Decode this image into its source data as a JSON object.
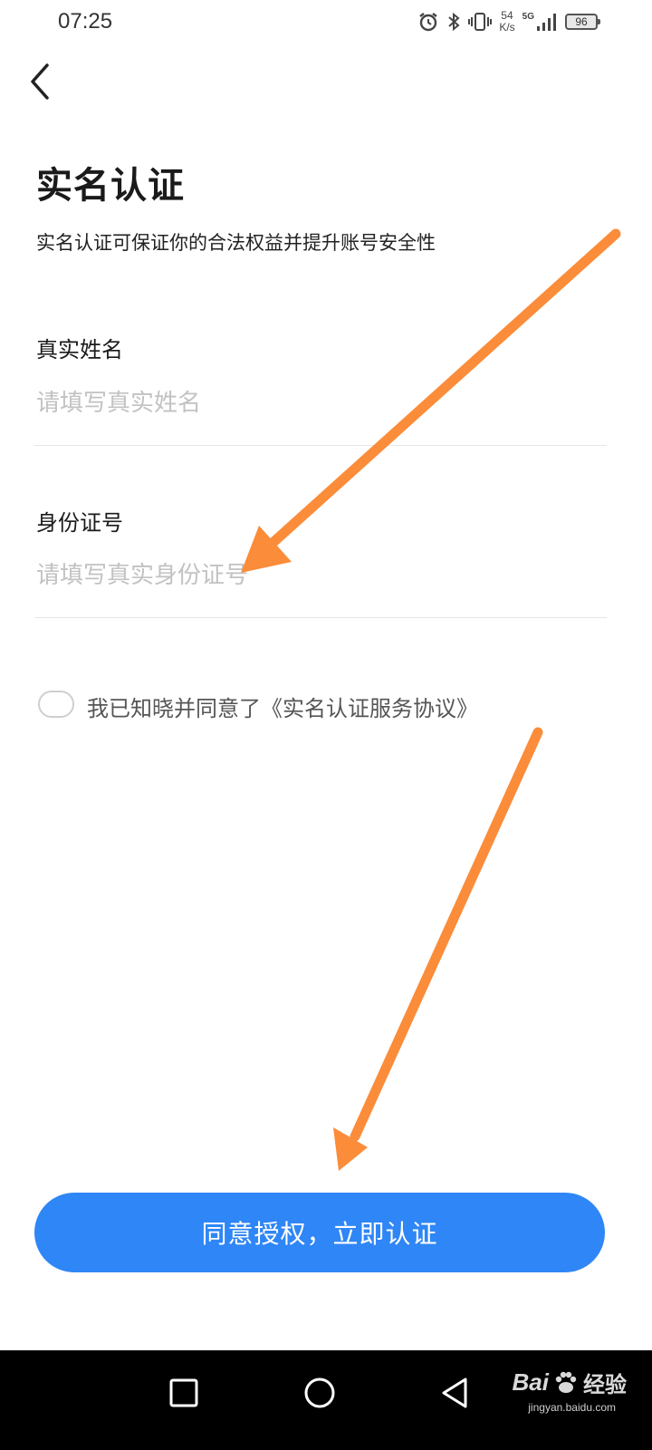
{
  "status_bar": {
    "time": "07:25",
    "net_speed_value": "54",
    "net_speed_unit": "K/s",
    "network": "5G",
    "battery": "96"
  },
  "header": {
    "title": "实名认证",
    "subtitle": "实名认证可保证你的合法权益并提升账号安全性"
  },
  "form": {
    "name_label": "真实姓名",
    "name_placeholder": "请填写真实姓名",
    "name_value": "",
    "id_label": "身份证号",
    "id_placeholder": "请填写真实身份证号",
    "id_value": ""
  },
  "agreement": {
    "checked": false,
    "text": "我已知晓并同意了",
    "link": "《实名认证服务协议》"
  },
  "submit_label": "同意授权，立即认证",
  "watermark": {
    "brand": "Bai",
    "brand_cn": "经验",
    "url": "jingyan.baidu.com"
  },
  "colors": {
    "accent": "#2f86f6",
    "annotation_arrow": "#fb8c3a",
    "placeholder": "#c2c2c2"
  }
}
